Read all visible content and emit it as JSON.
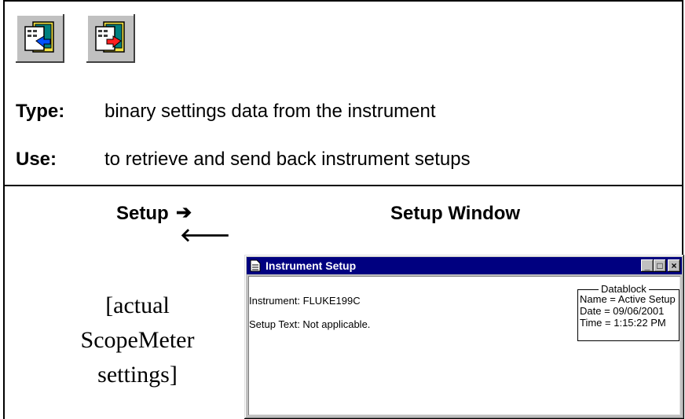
{
  "toolbar": {
    "buttons": [
      {
        "icon": "retrieve-setup-icon"
      },
      {
        "icon": "send-setup-icon"
      }
    ]
  },
  "info": {
    "type_label": "Type:",
    "type_text": "binary settings data from the instrument",
    "use_label": "Use:",
    "use_text": "to retrieve and send back instrument setups"
  },
  "setup_section": {
    "left_heading": "Setup",
    "arrow_right": "➔",
    "arrow_left": "🡐",
    "right_heading": "Setup Window",
    "note": "[actual ScopeMeter settings]"
  },
  "window": {
    "title": "Instrument Setup",
    "controls": {
      "minimize": "_",
      "maximize": "□",
      "close": "×"
    },
    "instrument_line": "Instrument:  FLUKE199C",
    "setup_text_line": "Setup Text: Not applicable.",
    "datablock": {
      "legend": "Datablock",
      "name_line": "Name = Active Setup",
      "date_line": "Date   = 09/06/2001",
      "time_line": "Time   = 1:15:22 PM"
    }
  },
  "colors": {
    "titlebar": "#000080",
    "chrome": "#c0c0c0"
  }
}
